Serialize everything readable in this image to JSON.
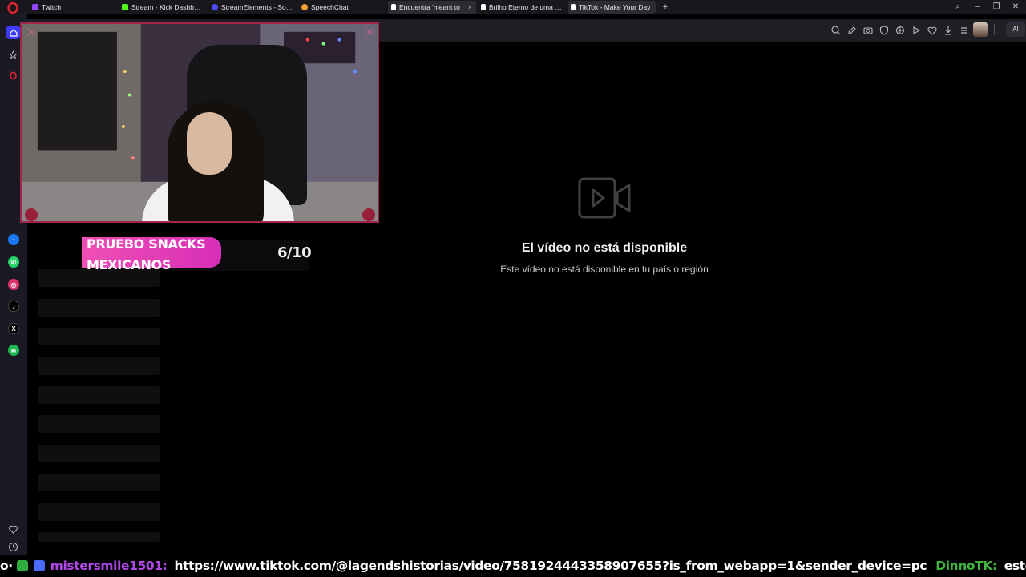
{
  "browser": {
    "tabs": [
      {
        "label": "Twitch",
        "favicon_color": "#9146ff",
        "active": false
      },
      {
        "label": "Stream - Kick Dashboard",
        "favicon_color": "#53fc18",
        "active": false
      },
      {
        "label": "StreamElements - Songreq",
        "favicon_color": "#4b4bff",
        "active": false
      },
      {
        "label": "SpeechChat",
        "favicon_color": "#f0a030",
        "active": false
      },
      {
        "label": "Encuentra 'meant to",
        "favicon_color": "#ffffff",
        "active": true
      },
      {
        "label": "Brilho Eterno de uma Men",
        "favicon_color": "#ffffff",
        "active": false
      },
      {
        "label": "TikTok - Make Your Day",
        "favicon_color": "#ffffff",
        "active": true
      }
    ],
    "close_glyph": "×",
    "new_tab_glyph": "+",
    "window_controls": {
      "search": "⌕",
      "minimize": "–",
      "restore": "❐",
      "close": "✕"
    },
    "ai_label": "AI"
  },
  "sidebar": {
    "apps": [
      {
        "name": "messenger",
        "color": "#1877f2",
        "glyph": "~"
      },
      {
        "name": "whatsapp",
        "color": "#25d366",
        "glyph": "✆"
      },
      {
        "name": "instagram",
        "color": "#e1306c",
        "glyph": "◎"
      },
      {
        "name": "tiktok",
        "color": "#111111",
        "glyph": "♪"
      },
      {
        "name": "x",
        "color": "#111111",
        "glyph": "X"
      },
      {
        "name": "spotify",
        "color": "#1db954",
        "glyph": "≋"
      }
    ]
  },
  "overlay": {
    "caption": "PRUEBO SNACKS MEXICANOS",
    "score": "6/10",
    "accent": "#e83fb8"
  },
  "video": {
    "title": "El vídeo no está disponible",
    "subtitle": "Este vídeo no está disponible en tu país o región"
  },
  "chat": {
    "prefix": "o·",
    "messages": [
      {
        "user": "mistersmile1501:",
        "text": "https://www.tiktok.com/@lagendshistorias/video/7581924443358907655?is_from_webapp=1&sender_device=pc",
        "color": "#b048e8"
      },
      {
        "user": "DinnoTK:",
        "text": "estoy apr",
        "color": "#3fb53f"
      }
    ]
  }
}
